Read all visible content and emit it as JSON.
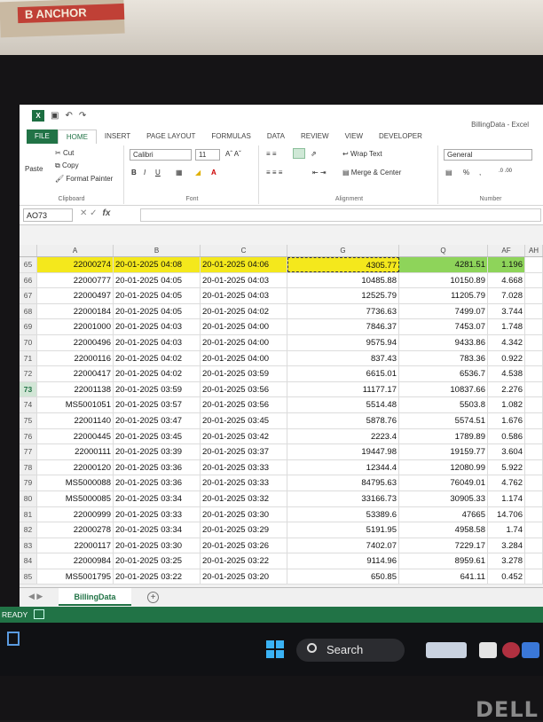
{
  "book": {
    "spine_text": "B ANCHOR"
  },
  "window": {
    "title": "BillingData - Excel"
  },
  "tabs": [
    "FILE",
    "HOME",
    "INSERT",
    "PAGE LAYOUT",
    "FORMULAS",
    "DATA",
    "REVIEW",
    "VIEW",
    "DEVELOPER"
  ],
  "ribbon": {
    "cut": "Cut",
    "copy": "Copy",
    "paste": "Paste",
    "format_painter": "Format Painter",
    "clipboard": "Clipboard",
    "font_name": "Calibri",
    "font_size": "11",
    "font": "Font",
    "wrap_text": "Wrap Text",
    "merge_center": "Merge & Center",
    "alignment": "Alignment",
    "number_format": "General",
    "number": "Number",
    "percent": "%"
  },
  "formula_bar": {
    "name_box": "AO73",
    "fx": "fx"
  },
  "columns": [
    "A",
    "B",
    "C",
    "G",
    "Q",
    "AF",
    "AH"
  ],
  "rows": [
    {
      "n": "65",
      "a": "22000274",
      "b": "20-01-2025 04:08",
      "c": "20-01-2025 04:06",
      "g": "4305.77",
      "q": "4281.51",
      "af": "1.196"
    },
    {
      "n": "66",
      "a": "22000777",
      "b": "20-01-2025 04:05",
      "c": "20-01-2025 04:03",
      "g": "10485.88",
      "q": "10150.89",
      "af": "4.668"
    },
    {
      "n": "67",
      "a": "22000497",
      "b": "20-01-2025 04:05",
      "c": "20-01-2025 04:03",
      "g": "12525.79",
      "q": "11205.79",
      "af": "7.028"
    },
    {
      "n": "68",
      "a": "22000184",
      "b": "20-01-2025 04:05",
      "c": "20-01-2025 04:02",
      "g": "7736.63",
      "q": "7499.07",
      "af": "3.744"
    },
    {
      "n": "69",
      "a": "22001000",
      "b": "20-01-2025 04:03",
      "c": "20-01-2025 04:00",
      "g": "7846.37",
      "q": "7453.07",
      "af": "1.748"
    },
    {
      "n": "70",
      "a": "22000496",
      "b": "20-01-2025 04:03",
      "c": "20-01-2025 04:00",
      "g": "9575.94",
      "q": "9433.86",
      "af": "4.342"
    },
    {
      "n": "71",
      "a": "22000116",
      "b": "20-01-2025 04:02",
      "c": "20-01-2025 04:00",
      "g": "837.43",
      "q": "783.36",
      "af": "0.922"
    },
    {
      "n": "72",
      "a": "22000417",
      "b": "20-01-2025 04:02",
      "c": "20-01-2025 03:59",
      "g": "6615.01",
      "q": "6536.7",
      "af": "4.538"
    },
    {
      "n": "73",
      "a": "22001138",
      "b": "20-01-2025 03:59",
      "c": "20-01-2025 03:56",
      "g": "11177.17",
      "q": "10837.66",
      "af": "2.276"
    },
    {
      "n": "74",
      "a": "MS5001051",
      "b": "20-01-2025 03:57",
      "c": "20-01-2025 03:56",
      "g": "5514.48",
      "q": "5503.8",
      "af": "1.082"
    },
    {
      "n": "75",
      "a": "22001140",
      "b": "20-01-2025 03:47",
      "c": "20-01-2025 03:45",
      "g": "5878.76",
      "q": "5574.51",
      "af": "1.676"
    },
    {
      "n": "76",
      "a": "22000445",
      "b": "20-01-2025 03:45",
      "c": "20-01-2025 03:42",
      "g": "2223.4",
      "q": "1789.89",
      "af": "0.586"
    },
    {
      "n": "77",
      "a": "22000111",
      "b": "20-01-2025 03:39",
      "c": "20-01-2025 03:37",
      "g": "19447.98",
      "q": "19159.77",
      "af": "3.604"
    },
    {
      "n": "78",
      "a": "22000120",
      "b": "20-01-2025 03:36",
      "c": "20-01-2025 03:33",
      "g": "12344.4",
      "q": "12080.99",
      "af": "5.922"
    },
    {
      "n": "79",
      "a": "MS5000088",
      "b": "20-01-2025 03:36",
      "c": "20-01-2025 03:33",
      "g": "84795.63",
      "q": "76049.01",
      "af": "4.762"
    },
    {
      "n": "80",
      "a": "MS5000085",
      "b": "20-01-2025 03:34",
      "c": "20-01-2025 03:32",
      "g": "33166.73",
      "q": "30905.33",
      "af": "1.174"
    },
    {
      "n": "81",
      "a": "22000999",
      "b": "20-01-2025 03:33",
      "c": "20-01-2025 03:30",
      "g": "53389.6",
      "q": "47665",
      "af": "14.706"
    },
    {
      "n": "82",
      "a": "22000278",
      "b": "20-01-2025 03:34",
      "c": "20-01-2025 03:29",
      "g": "5191.95",
      "q": "4958.58",
      "af": "1.74"
    },
    {
      "n": "83",
      "a": "22000117",
      "b": "20-01-2025 03:30",
      "c": "20-01-2025 03:26",
      "g": "7402.07",
      "q": "7229.17",
      "af": "3.284"
    },
    {
      "n": "84",
      "a": "22000984",
      "b": "20-01-2025 03:25",
      "c": "20-01-2025 03:22",
      "g": "9114.96",
      "q": "8959.61",
      "af": "3.278"
    },
    {
      "n": "85",
      "a": "MS5001795",
      "b": "20-01-2025 03:22",
      "c": "20-01-2025 03:20",
      "g": "650.85",
      "q": "641.11",
      "af": "0.452"
    }
  ],
  "sheet_tab": "BillingData",
  "status": "READY",
  "taskbar": {
    "search": "Search"
  },
  "brand": "DELL",
  "colors": {
    "excel_green": "#217346",
    "highlight_yellow": "#f4e81c",
    "highlight_green": "#8ed45a"
  }
}
